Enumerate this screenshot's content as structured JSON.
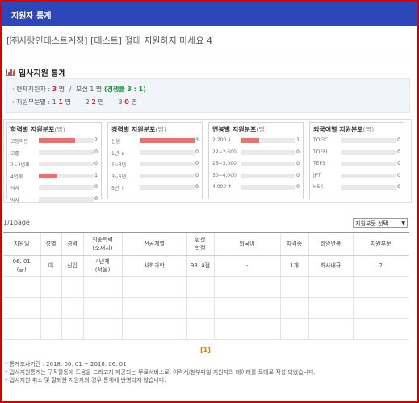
{
  "header": {
    "title": "지원자 통계"
  },
  "job": {
    "title": "[㈜사랑인테스트계정] [테스트] 절대 지원하지 마세요 4"
  },
  "section": {
    "title": "입사지원 통계"
  },
  "summary": {
    "current_label": "· 현재지원자 :",
    "current_count": "3",
    "unit_person": "명",
    "slash": "/",
    "recruit_label": "모집",
    "recruit_count": "1",
    "competition": "(경쟁률 3 : 1)",
    "dept_label": "· 지원부문별 :",
    "dept": [
      {
        "num": "1",
        "count": "1"
      },
      {
        "num": "2",
        "count": "2"
      },
      {
        "num": "3",
        "count": "0"
      }
    ]
  },
  "colors": {
    "accent": "#2e47b8",
    "bar": "#ef6f6a",
    "highlight": "#e02020",
    "ratio": "#1a9a31"
  },
  "chart_data": [
    {
      "type": "bar",
      "title": "학력별 지원분포",
      "unit": "(명)",
      "categories": [
        "고등미만",
        "고졸",
        "2~3년제",
        "4년제",
        "석사",
        "박사"
      ],
      "values": [
        2,
        0,
        0,
        1,
        0,
        0
      ],
      "xlim": [
        0,
        3
      ]
    },
    {
      "type": "bar",
      "title": "경력별 지원분포",
      "unit": "(명)",
      "categories": [
        "신입",
        "1년 ↓",
        "1~3년",
        "3~5년",
        "5년 ↑"
      ],
      "values": [
        3,
        0,
        0,
        0,
        0
      ],
      "xlim": [
        0,
        3
      ]
    },
    {
      "type": "bar",
      "title": "연봉별 지원분포",
      "unit": "(명)",
      "categories": [
        "2,200 ↓",
        "22~2,600",
        "26~3,000",
        "30~4,000",
        "4,000 ↑"
      ],
      "values": [
        1,
        0,
        0,
        0,
        0
      ],
      "xlim": [
        0,
        3
      ]
    },
    {
      "type": "bar",
      "title": "외국어별 지원분포",
      "unit": "(명)",
      "categories": [
        "TOEIC",
        "TOEFL",
        "TEPS",
        "JPT",
        "HSK"
      ],
      "values": [
        0,
        0,
        0,
        0,
        0
      ],
      "xlim": [
        0,
        3
      ]
    }
  ],
  "list": {
    "page_info": "1/1page",
    "filter": {
      "selected": "지원부문 선택"
    },
    "columns": [
      "지원일",
      "성별",
      "경력",
      "최종학력\n(소재지)",
      "전공계열",
      "환산\n학점",
      "외국어",
      "자격증",
      "희망연봉",
      "지원부문"
    ],
    "rows": [
      [
        "06. 01\n(금)",
        "여",
        "신입",
        "4년제\n(서울)",
        "사회과학",
        "93. 4점",
        "-",
        "1개",
        "회사내규",
        "2"
      ]
    ]
  },
  "pagination": {
    "current": "[1]"
  },
  "notes": [
    "* 통계조사기간 : 2018. 06. 01 ~ 2018. 06. 01",
    "* 입사지원통계는 구직활동에 도움을 드리고자 제공되는 무료서비스로, 이력서/첨부파일 지원자의 데이터를 토대로 작성 되었습니다.",
    "* 입사지원 취소 및 탈퇴한 지원자의 경우 통계에 반영되지 않습니다."
  ]
}
